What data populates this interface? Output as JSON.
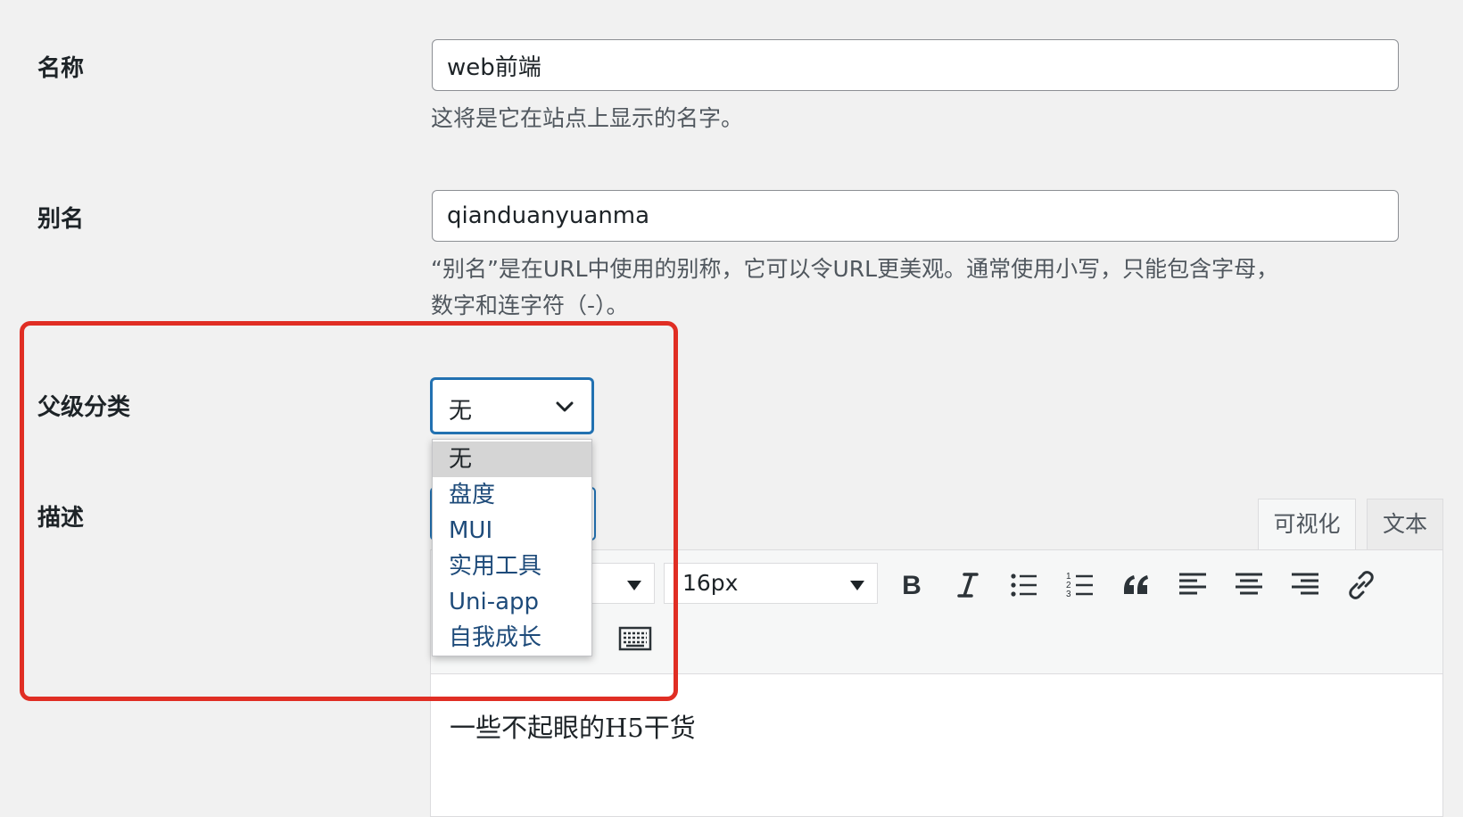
{
  "fields": {
    "name": {
      "label": "名称",
      "value": "web前端",
      "help": "这将是它在站点上显示的名字。"
    },
    "slug": {
      "label": "别名",
      "value": "qianduanyuanma",
      "help_line1": "“别名”是在URL中使用的别称，它可以令URL更美观。通常使用小写，只能包含字母，",
      "help_line2": "数字和连字符（-）。"
    },
    "parent": {
      "label": "父级分类",
      "selected": "无",
      "options": [
        "无",
        "盘度",
        "MUI",
        "实用工具",
        "Uni-app",
        "自我成长"
      ]
    },
    "description": {
      "label": "描述",
      "content": "一些不起眼的H5干货"
    }
  },
  "editor": {
    "tabs": [
      "可视化",
      "文本"
    ],
    "font_size": "16px",
    "toolbar_icons": [
      "bold-icon",
      "italic-icon",
      "bulleted-list-icon",
      "numbered-list-icon",
      "blockquote-icon",
      "align-left-icon",
      "align-center-icon",
      "align-right-icon",
      "link-icon",
      "keyboard-icon"
    ]
  },
  "colors": {
    "highlight_border": "#e02e24",
    "focus_blue": "#2271b1",
    "option_link": "#1e4b7a"
  }
}
